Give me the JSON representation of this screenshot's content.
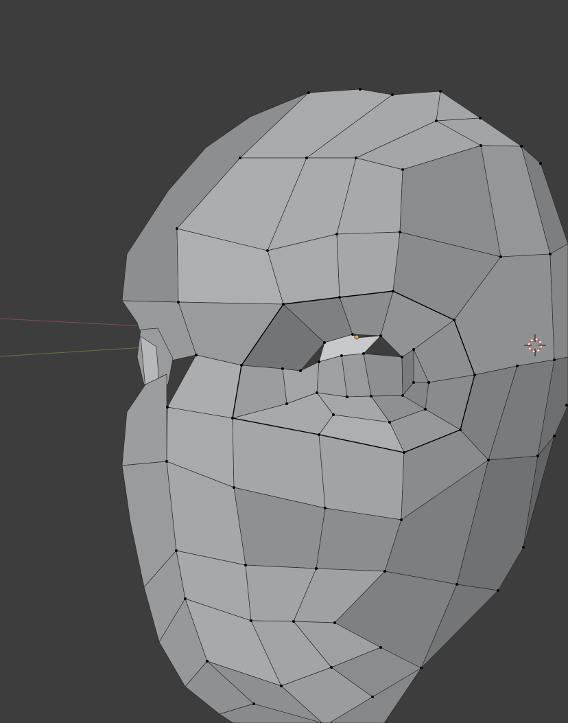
{
  "viewport": {
    "background_color": "#3d3d3d",
    "mesh_face_color": "#a0a1a3",
    "mesh_edge_color": "#222222",
    "vertex_color": "#000000",
    "active_vertex_color": "#f2a33a",
    "x_axis_color": "#8a4a52",
    "y_axis_color": "#5f7a3a",
    "cursor_ring_color": "#d84848",
    "icons": [
      "3d-cursor-icon"
    ]
  }
}
